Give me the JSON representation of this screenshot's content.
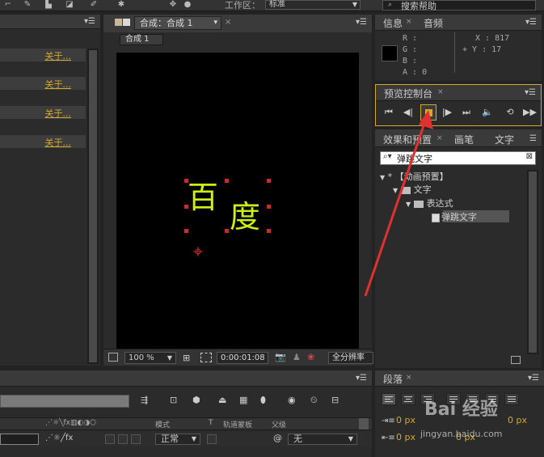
{
  "toolbar": {
    "workspace_label": "工作区：",
    "workspace_value": "标准",
    "search_help": "搜索帮助"
  },
  "project": {
    "rows": [
      "关于...",
      "关于...",
      "关于...",
      "关于..."
    ]
  },
  "comp": {
    "tab_title": "合成：合成 1",
    "sub_tab": "合成 1",
    "text_chars": [
      "百",
      "度"
    ],
    "zoom": "100 %",
    "timecode": "0:00:01:08",
    "resolution": "全分辨率"
  },
  "info": {
    "tab_info": "信息",
    "tab_audio": "音频",
    "r": "R :",
    "g": "G :",
    "b": "B :",
    "a": "A : 0",
    "x": "X : 817",
    "y": "+ Y : 17"
  },
  "preview": {
    "tab_label": "预览控制台"
  },
  "effects": {
    "tab_effects": "效果和预置",
    "tab_brush": "画笔",
    "tab_text": "文字",
    "search_value": "弹跳文字",
    "tree": [
      {
        "label": "* 【动画预置】",
        "level": 0
      },
      {
        "label": "文字",
        "level": 1
      },
      {
        "label": "表达式",
        "level": 2
      },
      {
        "label": "弹跳文字",
        "level": 3
      }
    ]
  },
  "timeline": {
    "col_mode": "模式",
    "col_t": "T",
    "col_track": "轨道蒙板",
    "col_parent": "父级",
    "mode_value": "正常",
    "parent_value": "无"
  },
  "paragraph": {
    "tab_label": "段落",
    "indent_left": "0 px",
    "indent_first": "0 px",
    "indent_right": "0 px",
    "space_after": "0 px"
  },
  "watermark": {
    "brand": "Bai 经验",
    "url": "jingyan.baidu.com"
  },
  "colors": {
    "accent": "#d4a92c",
    "text_fill": "#ccf00f",
    "arrow": "#e03030"
  }
}
